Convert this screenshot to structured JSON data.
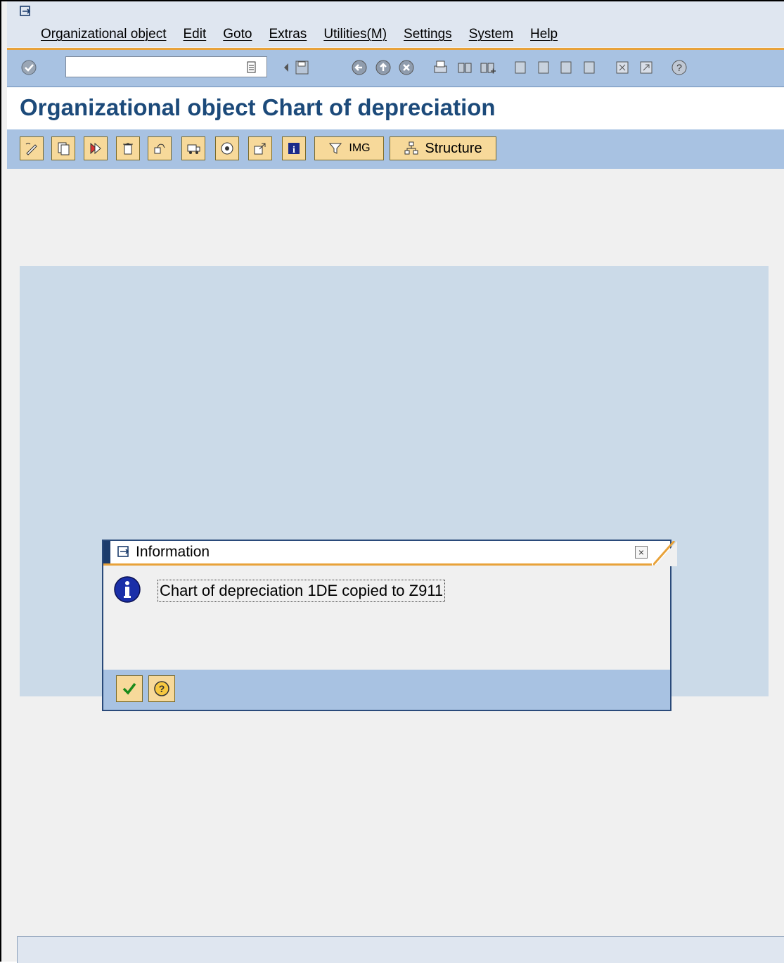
{
  "menu": {
    "items": [
      "Organizational object",
      "Edit",
      "Goto",
      "Extras",
      "Utilities(M)",
      "Settings",
      "System",
      "Help"
    ]
  },
  "page": {
    "title": "Organizational object Chart of depreciation"
  },
  "app_toolbar": {
    "img_label": "IMG",
    "structure_label": "Structure"
  },
  "dialog": {
    "title": "Information",
    "message": "Chart of depreciation 1DE copied to Z911"
  },
  "icons": {
    "system": "system-menu-icon",
    "enter": "enter-check-icon",
    "save": "save-icon",
    "back": "back-icon",
    "exit": "exit-icon",
    "cancel": "cancel-icon",
    "print": "print-icon",
    "find": "find-icon",
    "help": "help-icon"
  },
  "colors": {
    "accent_orange": "#e8a23a",
    "title_blue": "#1c4a7a",
    "toolbar_blue": "#a8c2e2"
  }
}
